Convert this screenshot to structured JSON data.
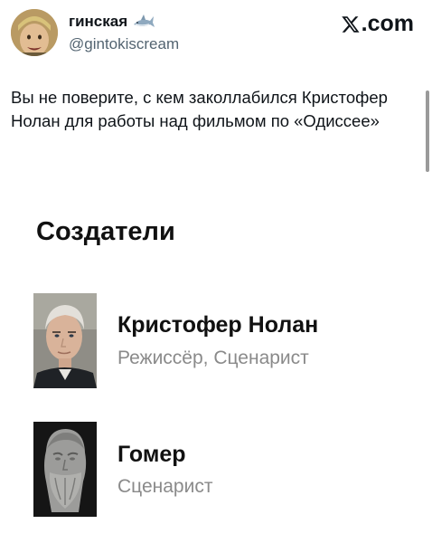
{
  "tweet": {
    "author_name": "гинская",
    "author_icon": "shark-icon",
    "handle": "@gintokiscream",
    "source": ".com",
    "text": "Вы не поверите, с кем заколлабился Кристофер Нолан для работы над фильмом по «Одиссее»"
  },
  "embedded": {
    "section_title": "Создатели",
    "people": [
      {
        "name": "Кристофер Нолан",
        "role": "Режиссёр, Сценарист",
        "photo": "photo-portrait"
      },
      {
        "name": "Гомер",
        "role": "Сценарист",
        "photo": "bust-statue"
      }
    ]
  }
}
